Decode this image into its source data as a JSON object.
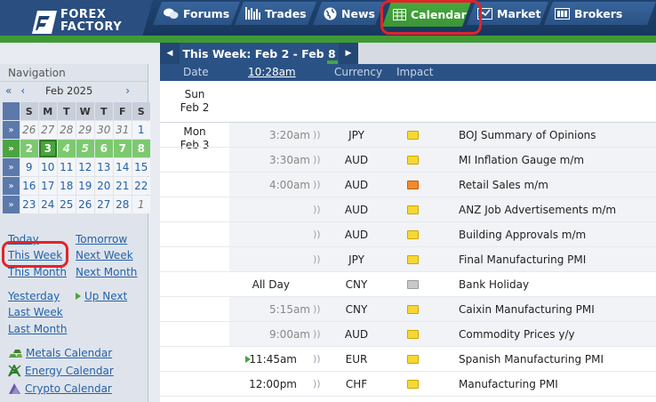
{
  "brand": {
    "line1": "FOREX",
    "line2": "FACTORY"
  },
  "nav": {
    "forums": "Forums",
    "trades": "Trades",
    "news": "News",
    "calendar": "Calendar",
    "market": "Market",
    "brokers": "Brokers"
  },
  "colors": {
    "accent_green": "#3f9a35",
    "nav_blue": "#2b5285",
    "highlight_red": "#e0242a"
  },
  "sidebar": {
    "title": "Navigation",
    "prev_year": "«",
    "prev_month": "‹",
    "month": "Feb 2025",
    "next_month": "›",
    "weekdays": [
      "S",
      "M",
      "T",
      "W",
      "T",
      "F",
      "S"
    ],
    "week_marker": "»",
    "weeks": [
      [
        "26",
        "27",
        "28",
        "29",
        "30",
        "31",
        "1"
      ],
      [
        "2",
        "3",
        "4",
        "5",
        "6",
        "7",
        "8"
      ],
      [
        "9",
        "10",
        "11",
        "12",
        "13",
        "14",
        "15"
      ],
      [
        "16",
        "17",
        "18",
        "19",
        "20",
        "21",
        "22"
      ],
      [
        "23",
        "24",
        "25",
        "26",
        "27",
        "28",
        "1"
      ]
    ],
    "links": {
      "today": "Today",
      "tomorrow": "Tomorrow",
      "this_week": "This Week",
      "next_week": "Next Week",
      "this_month": "This Month",
      "next_month": "Next Month",
      "yesterday": "Yesterday",
      "up_next": "Up Next",
      "last_week": "Last Week",
      "last_month": "Last Month"
    },
    "calendars": {
      "metals": "Metals Calendar",
      "energy": "Energy Calendar",
      "crypto": "Crypto Calendar"
    }
  },
  "main": {
    "week_label": "This Week: Feb 2 - Feb 8",
    "prev_arrow": "◀",
    "next_arrow": "▶",
    "columns": {
      "date": "Date",
      "time": "10:28am",
      "currency": "Currency",
      "impact": "Impact"
    },
    "days": [
      {
        "dow": "Sun",
        "date": "Feb 2"
      },
      {
        "dow": "Mon",
        "date": "Feb 3"
      }
    ],
    "events": [
      {
        "time": "3:20am",
        "currency": "JPY",
        "impact": "yellow",
        "event": "BOJ Summary of Opinions"
      },
      {
        "time": "3:30am",
        "currency": "AUD",
        "impact": "yellow",
        "event": "MI Inflation Gauge m/m"
      },
      {
        "time": "4:00am",
        "currency": "AUD",
        "impact": "orange",
        "event": "Retail Sales m/m"
      },
      {
        "time": "",
        "currency": "AUD",
        "impact": "yellow",
        "event": "ANZ Job Advertisements m/m"
      },
      {
        "time": "",
        "currency": "AUD",
        "impact": "yellow",
        "event": "Building Approvals m/m"
      },
      {
        "time": "",
        "currency": "JPY",
        "impact": "yellow",
        "event": "Final Manufacturing PMI"
      },
      {
        "time": "All Day",
        "currency": "CNY",
        "impact": "gray",
        "event": "Bank Holiday"
      },
      {
        "time": "5:15am",
        "currency": "CNY",
        "impact": "yellow",
        "event": "Caixin Manufacturing PMI"
      },
      {
        "time": "9:00am",
        "currency": "AUD",
        "impact": "yellow",
        "event": "Commodity Prices y/y"
      },
      {
        "time": "11:45am",
        "currency": "EUR",
        "impact": "yellow",
        "event": "Spanish Manufacturing PMI"
      },
      {
        "time": "12:00pm",
        "currency": "CHF",
        "impact": "yellow",
        "event": "Manufacturing PMI"
      }
    ]
  }
}
